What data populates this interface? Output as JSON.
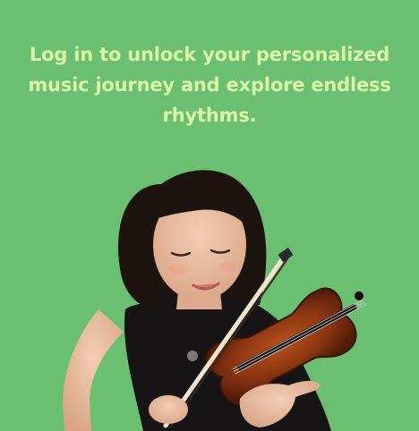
{
  "login_promo": {
    "headline": "Log in to unlock your personalized music journey and explore endless rhythms."
  },
  "colors": {
    "background": "#6bbf71",
    "headline_text": "#d9f5a6"
  }
}
